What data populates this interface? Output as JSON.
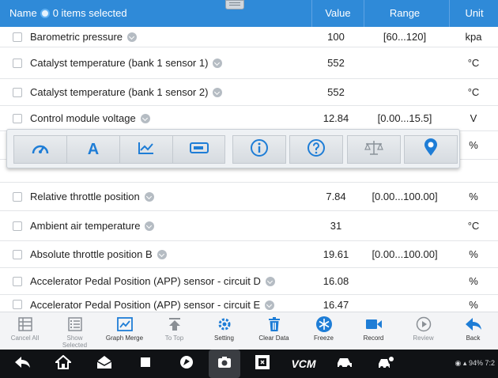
{
  "header": {
    "name_label": "Name",
    "selection_text": "0 items selected",
    "value_label": "Value",
    "range_label": "Range",
    "unit_label": "Unit"
  },
  "rows": [
    {
      "label": "Barometric pressure",
      "value": "100",
      "range": "[60...120]",
      "unit": "kpa"
    },
    {
      "label": "Catalyst temperature (bank 1 sensor 1)",
      "value": "552",
      "range": "",
      "unit": "°C"
    },
    {
      "label": "Catalyst temperature (bank 1 sensor 2)",
      "value": "552",
      "range": "",
      "unit": "°C"
    },
    {
      "label": "Control module voltage",
      "value": "12.84",
      "range": "[0.00...15.5]",
      "unit": "V"
    },
    {
      "label": "",
      "value": "",
      "range": "",
      "unit": "%"
    },
    {
      "label": "Relative throttle position",
      "value": "7.84",
      "range": "[0.00...100.00]",
      "unit": "%"
    },
    {
      "label": "Ambient air temperature",
      "value": "31",
      "range": "",
      "unit": "°C"
    },
    {
      "label": "Absolute throttle position B",
      "value": "19.61",
      "range": "[0.00...100.00]",
      "unit": "%"
    },
    {
      "label": "Accelerator Pedal Position (APP) sensor - circuit D",
      "value": "16.08",
      "range": "",
      "unit": "%"
    },
    {
      "label": "Accelerator Pedal Position (APP) sensor - circuit E",
      "value": "16.47",
      "range": "",
      "unit": "%"
    }
  ],
  "popup_toolbar": {
    "icons": [
      "gauge-icon",
      "text-a-icon",
      "line-graph-icon",
      "digital-display-icon",
      "info-icon",
      "help-icon",
      "balance-icon",
      "location-pin-icon"
    ],
    "letter_a": "A"
  },
  "toolbar": {
    "cancel_all": "Cancel All",
    "show_selected": "Show Selected",
    "graph_merge": "Graph Merge",
    "to_top": "To Top",
    "setting": "Setting",
    "clear_data": "Clear Data",
    "freeze": "Freeze",
    "record": "Record",
    "review": "Review",
    "back": "Back"
  },
  "status_bar": {
    "text": "94% 7:2"
  },
  "nav_bar": {
    "vcm_label": "VCM"
  },
  "colors": {
    "header_bg": "#2f8ad8",
    "accent": "#1e7dd6",
    "nav_bg": "#101215"
  }
}
